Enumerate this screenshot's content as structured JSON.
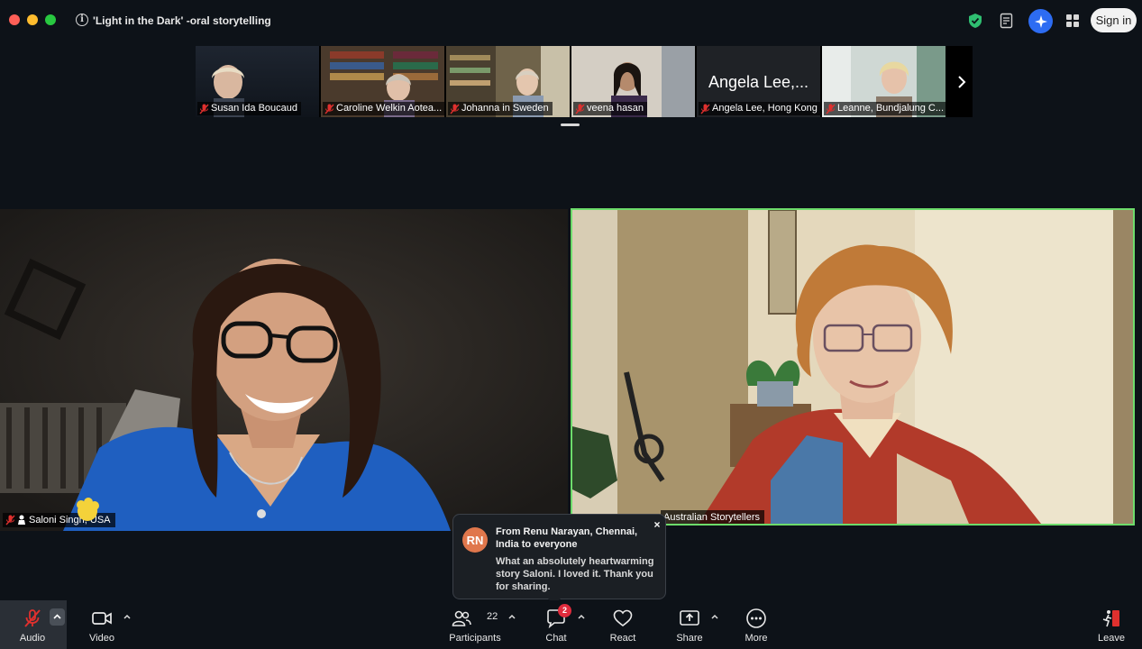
{
  "window": {
    "title": "'Light in the Dark' -oral storytelling",
    "info_glyph": "i",
    "sign_in_label": "Sign in",
    "icons": [
      "shield-check-icon",
      "notes-icon",
      "ai-companion-icon",
      "apps-icon"
    ]
  },
  "gallery": {
    "tiles": [
      {
        "name": "Susan Ida Boucaud",
        "muted": true
      },
      {
        "name": "Caroline Welkin Aotea...",
        "muted": true
      },
      {
        "name": "Johanna in Sweden",
        "muted": true
      },
      {
        "name": "veena hasan",
        "muted": true
      },
      {
        "name": "Angela Lee, Hong Kong",
        "muted": true,
        "video_off_name": "Angela Lee,..."
      },
      {
        "name": "Leanne, Bundjalung C...",
        "muted": true
      }
    ],
    "next_arrow": "›"
  },
  "main": {
    "left": {
      "name": "Saloni Singh, USA"
    },
    "right": {
      "name": "Australian Storytellers"
    }
  },
  "chat_toast": {
    "avatar_initials": "RN",
    "from": "From Renu Narayan, Chennai, India to everyone",
    "message": "What an absolutely heartwarming story Saloni. I loved it. Thank you for sharing.",
    "close_glyph": "×"
  },
  "toolbar": {
    "audio_label": "Audio",
    "video_label": "Video",
    "participants_label": "Participants",
    "participants_count": "22",
    "chat_label": "Chat",
    "chat_badge": "2",
    "react_label": "React",
    "share_label": "Share",
    "more_label": "More",
    "leave_label": "Leave",
    "caret": "⌃"
  },
  "colors": {
    "background": "#0d1218",
    "active_speaker_border": "#6ddc6b",
    "mute_red": "#e0302e",
    "ai_blue": "#2d6cf2",
    "badge_red": "#e02b3c",
    "avatar_orange": "#e0774c"
  }
}
